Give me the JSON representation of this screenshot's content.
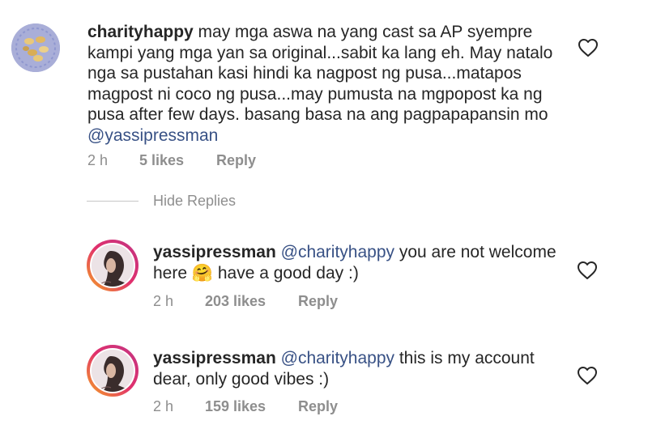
{
  "comments": [
    {
      "username": "charityhappy",
      "text": " may mga aswa na yang cast sa AP syempre kampi yang mga yan sa original...sabit ka lang eh. May natalo nga sa pustahan kasi hindi ka nagpost ng pusa...matapos magpost ni coco ng pusa...may pumusta na mgpopost ka ng pusa after few days. basang basa na ang pagpapapansin mo ",
      "mention": "@yassipressman",
      "time": "2 h",
      "likes": "5 likes",
      "reply": "Reply"
    }
  ],
  "hide_replies_label": "Hide Replies",
  "replies": [
    {
      "username": "yassipressman",
      "mention": "@charityhappy",
      "text": " you are not welcome here ",
      "emoji": "🤗",
      "text_after": "  have a good day :)",
      "time": "2 h",
      "likes": "203 likes",
      "reply": "Reply"
    },
    {
      "username": "yassipressman",
      "mention": "@charityhappy",
      "text": " this is my account dear, only good vibes :)",
      "time": "2 h",
      "likes": "159 likes",
      "reply": "Reply"
    }
  ],
  "colors": {
    "text": "#262626",
    "muted": "#8e8e8e",
    "mention": "#385185",
    "ring_start": "#f5a623",
    "ring_end": "#c13584"
  },
  "icons": {
    "like": "heart-outline-icon"
  }
}
